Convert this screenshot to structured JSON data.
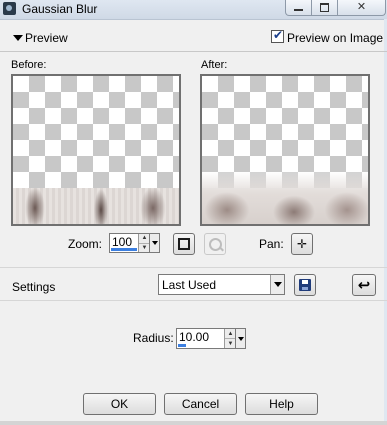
{
  "window": {
    "title": "Gaussian Blur",
    "minimize_icon": "minimize-icon",
    "maximize_icon": "maximize-icon",
    "close_icon": "close-icon",
    "close_glyph": "✕"
  },
  "preview": {
    "section_label": "Preview",
    "preview_on_image_label": "Preview on Image",
    "preview_on_image_checked": true,
    "before_label": "Before:",
    "after_label": "After:"
  },
  "zoom": {
    "label": "Zoom:",
    "value": "100",
    "pan_label": "Pan:",
    "pan_glyph": "✛"
  },
  "settings": {
    "label": "Settings",
    "selected_preset": "Last Used"
  },
  "radius": {
    "label": "Radius:",
    "value": "10.00"
  },
  "buttons": {
    "ok": "OK",
    "cancel": "Cancel",
    "help": "Help"
  },
  "colors": {
    "accent": "#3c7fe0",
    "titlebar": "#dfe7f1",
    "dialog_bg": "#f0f0f0"
  }
}
